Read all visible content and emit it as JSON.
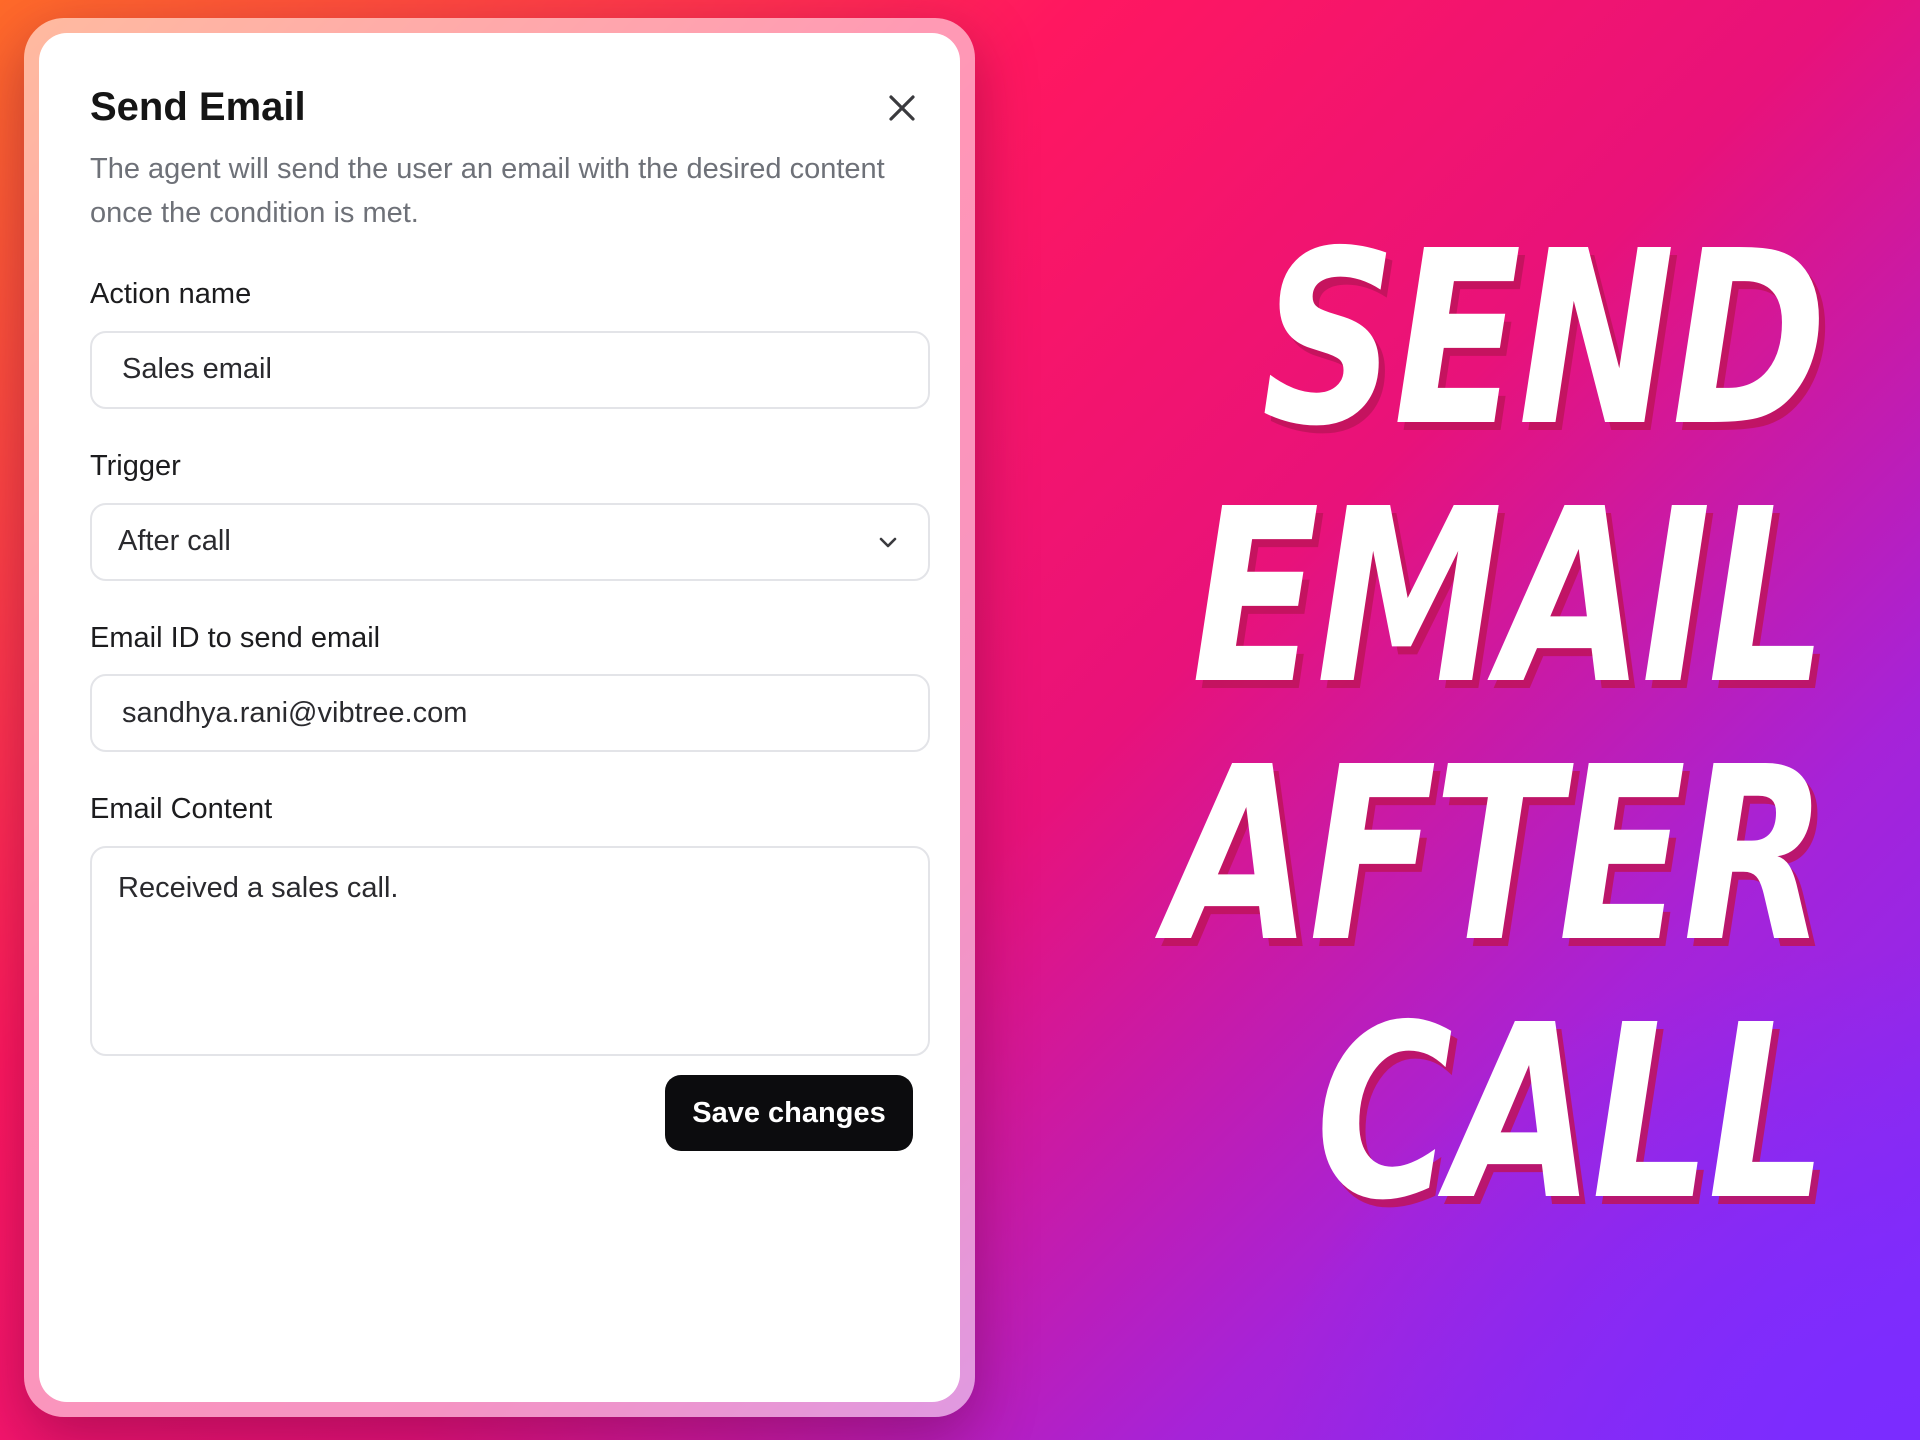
{
  "dialog": {
    "title": "Send Email",
    "description": "The agent will send the user an email with the desired content once the condition is met.",
    "close_icon": "close-icon",
    "fields": {
      "action_name": {
        "label": "Action name",
        "value": "Sales email"
      },
      "trigger": {
        "label": "Trigger",
        "value": "After call",
        "icon": "chevron-down-icon"
      },
      "email_id": {
        "label": "Email ID to send email",
        "value": "sandhya.rani@vibtree.com"
      },
      "email_content": {
        "label": "Email Content",
        "value": "Received a sales call."
      }
    },
    "save_label": "Save changes"
  },
  "headline": {
    "lines": [
      "SEND",
      "EMAIL",
      "AFTER",
      "CALL"
    ]
  },
  "colors": {
    "background_start": "#ff6a2a",
    "background_mid": "#ff1760",
    "background_end": "#7d2dff",
    "button": "#0c0c0e",
    "headline_shadow": "#be145a"
  }
}
